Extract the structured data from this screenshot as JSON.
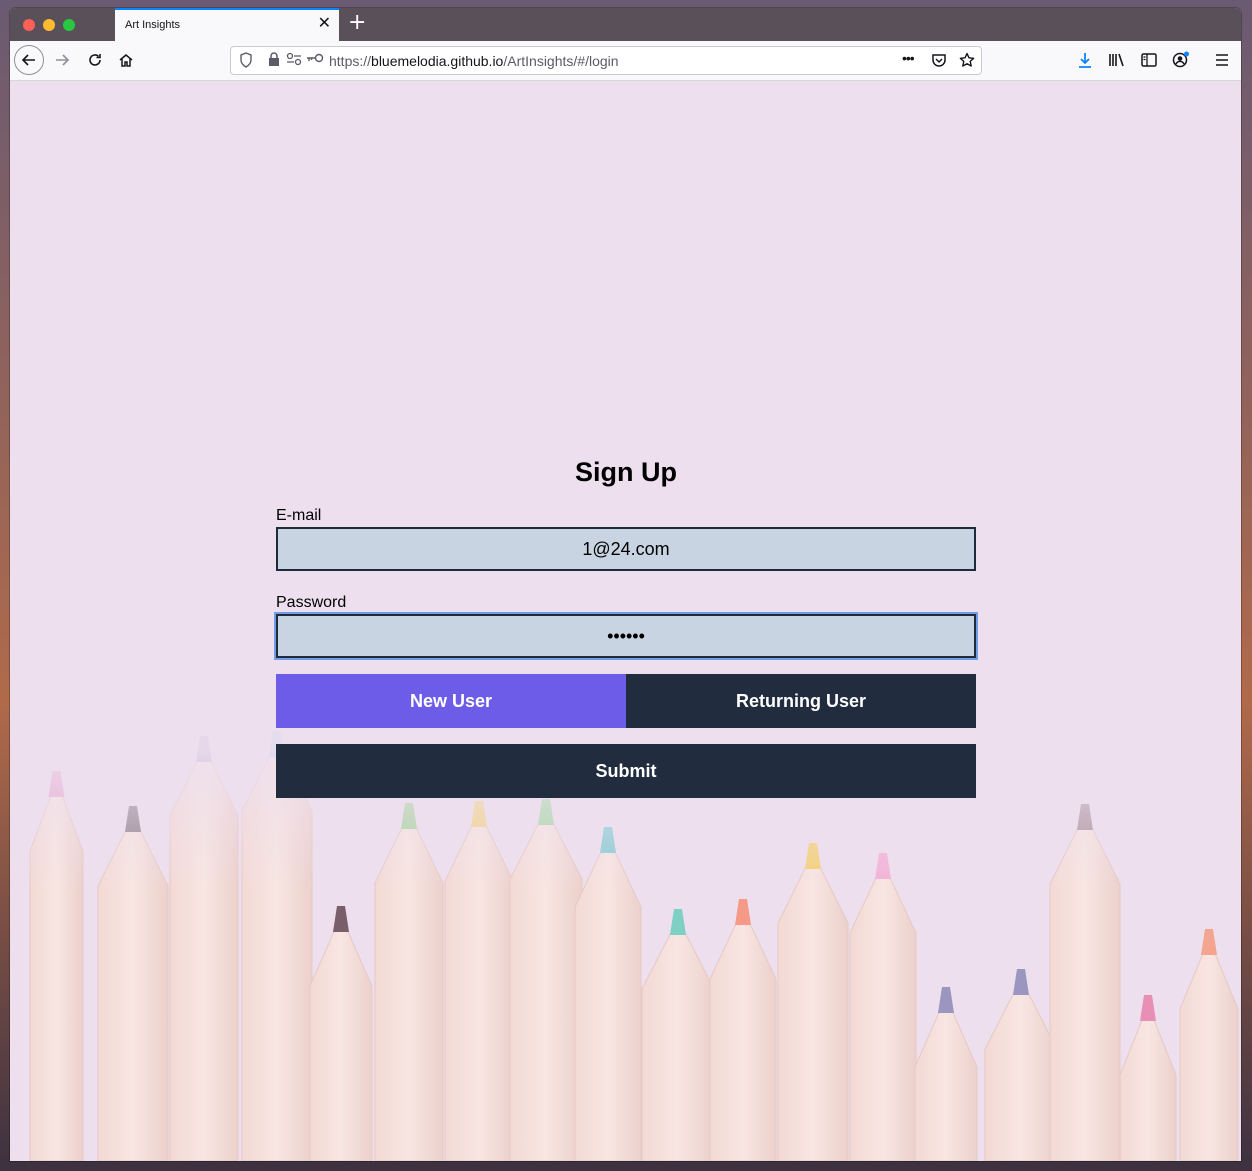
{
  "browser": {
    "tab_title": "Art Insights",
    "tab_close_glyph": "✕",
    "new_tab_glyph": "+",
    "url_prefix": "https://",
    "url_host": "bluemelodia.github.io",
    "url_path": "/ArtInsights/#/login",
    "page_actions_glyph": "•••"
  },
  "form": {
    "title": "Sign Up",
    "email_label": "E-mail",
    "email_value": "1@24.com",
    "password_label": "Password",
    "password_value": "••••••",
    "new_user_label": "New User",
    "returning_user_label": "Returning User",
    "submit_label": "Submit"
  },
  "colors": {
    "accent": "#6c5ce7",
    "dark_button": "#212d3e",
    "input_bg": "#c9d4e3",
    "page_bg": "#eddfee"
  }
}
